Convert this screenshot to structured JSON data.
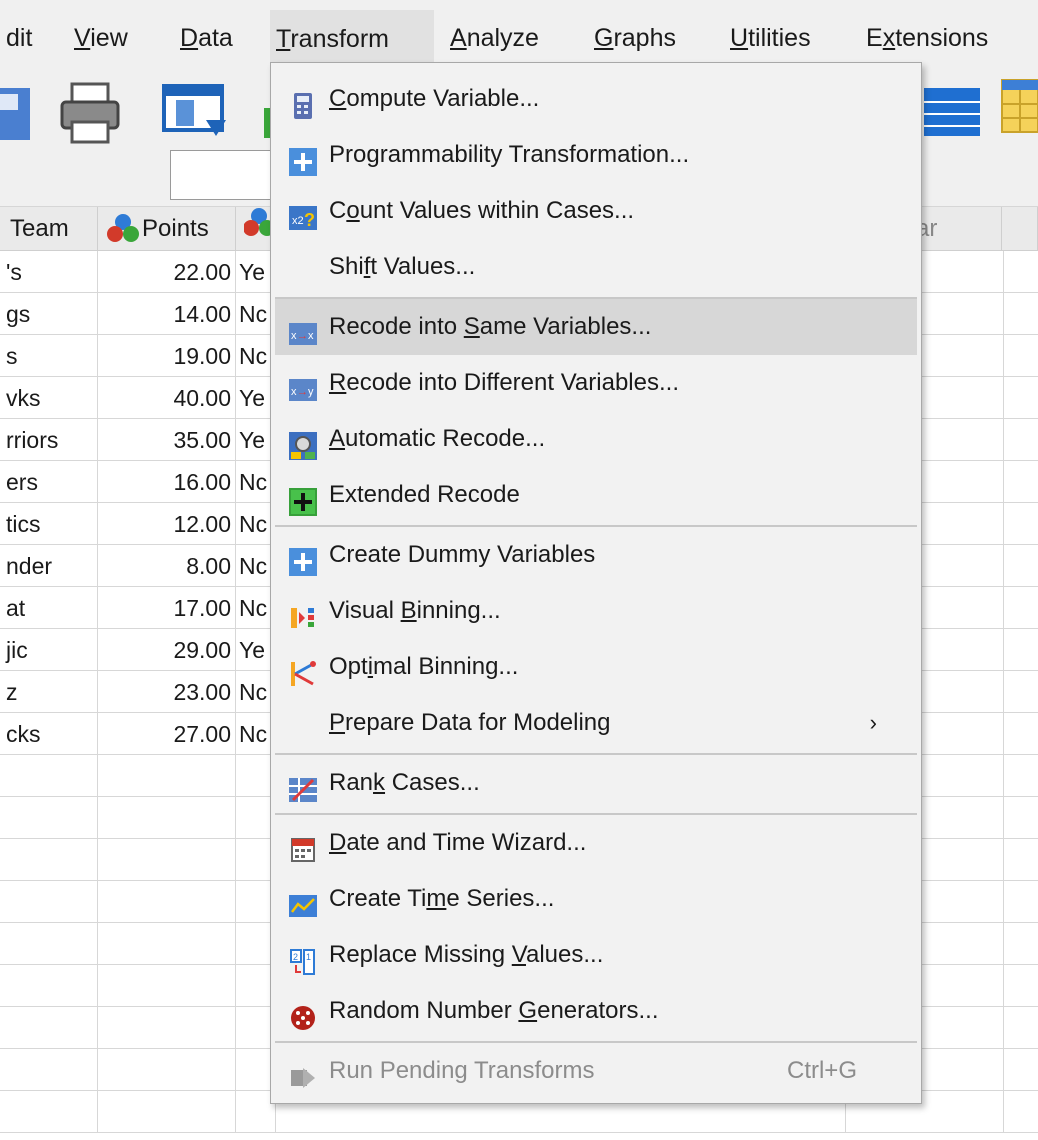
{
  "menubar": {
    "items": [
      {
        "label": "dit"
      },
      {
        "label": "View"
      },
      {
        "label": "Data"
      },
      {
        "label": "Transform"
      },
      {
        "label": "Analyze"
      },
      {
        "label": "Graphs"
      },
      {
        "label": "Utilities"
      },
      {
        "label": "Extensions"
      }
    ]
  },
  "grid": {
    "headers": {
      "team": "Team",
      "points": "Points",
      "right_partial": "ar"
    },
    "rows": [
      {
        "team": "'s",
        "points": "22.00",
        "third": "Ye"
      },
      {
        "team": "gs",
        "points": "14.00",
        "third": "Nc"
      },
      {
        "team": "s",
        "points": "19.00",
        "third": "Nc"
      },
      {
        "team": "vks",
        "points": "40.00",
        "third": "Ye"
      },
      {
        "team": "rriors",
        "points": "35.00",
        "third": "Ye"
      },
      {
        "team": "ers",
        "points": "16.00",
        "third": "Nc"
      },
      {
        "team": "tics",
        "points": "12.00",
        "third": "Nc"
      },
      {
        "team": "nder",
        "points": "8.00",
        "third": "Nc"
      },
      {
        "team": "at",
        "points": "17.00",
        "third": "Nc"
      },
      {
        "team": "jic",
        "points": "29.00",
        "third": "Ye"
      },
      {
        "team": "z",
        "points": "23.00",
        "third": "Nc"
      },
      {
        "team": "cks",
        "points": "27.00",
        "third": "Nc"
      }
    ]
  },
  "dropdown": {
    "items": [
      {
        "pre": "",
        "u": "C",
        "post": "ompute Variable...",
        "icon": "calculator-icon"
      },
      {
        "pre": "Programmability Transformation...",
        "u": "",
        "post": "",
        "icon": "plus-icon"
      },
      {
        "pre": "C",
        "u": "o",
        "post": "unt Values within Cases...",
        "icon": "count-values-icon"
      },
      {
        "pre": "Shi",
        "u": "f",
        "post": "t Values...",
        "icon": ""
      },
      {
        "pre": "Recode into ",
        "u": "S",
        "post": "ame Variables...",
        "icon": "recode-same-icon"
      },
      {
        "pre": "",
        "u": "R",
        "post": "ecode into Different Variables...",
        "icon": "recode-different-icon"
      },
      {
        "pre": "",
        "u": "A",
        "post": "utomatic Recode...",
        "icon": "automatic-recode-icon"
      },
      {
        "pre": "Extended Recode",
        "u": "",
        "post": "",
        "icon": "extended-recode-icon"
      },
      {
        "pre": "Create Dummy Variables",
        "u": "",
        "post": "",
        "icon": "plus-icon"
      },
      {
        "pre": "Visual ",
        "u": "B",
        "post": "inning...",
        "icon": "visual-binning-icon"
      },
      {
        "pre": "Opt",
        "u": "i",
        "post": "mal Binning...",
        "icon": "optimal-binning-icon"
      },
      {
        "pre": "",
        "u": "P",
        "post": "repare Data for Modeling",
        "icon": ""
      },
      {
        "pre": "Ran",
        "u": "k",
        "post": " Cases...",
        "icon": "rank-cases-icon"
      },
      {
        "pre": "",
        "u": "D",
        "post": "ate and Time Wizard...",
        "icon": "date-time-icon"
      },
      {
        "pre": "Create Ti",
        "u": "m",
        "post": "e Series...",
        "icon": "time-series-icon"
      },
      {
        "pre": "Replace Missing ",
        "u": "V",
        "post": "alues...",
        "icon": "replace-missing-icon"
      },
      {
        "pre": "Random Number ",
        "u": "G",
        "post": "enerators...",
        "icon": "dice-icon"
      },
      {
        "pre": "Run Pending Transforms",
        "u": "",
        "post": "",
        "icon": "run-pending-icon"
      }
    ],
    "prepare_chevron": "›",
    "run_pending_shortcut": "Ctrl+G"
  }
}
